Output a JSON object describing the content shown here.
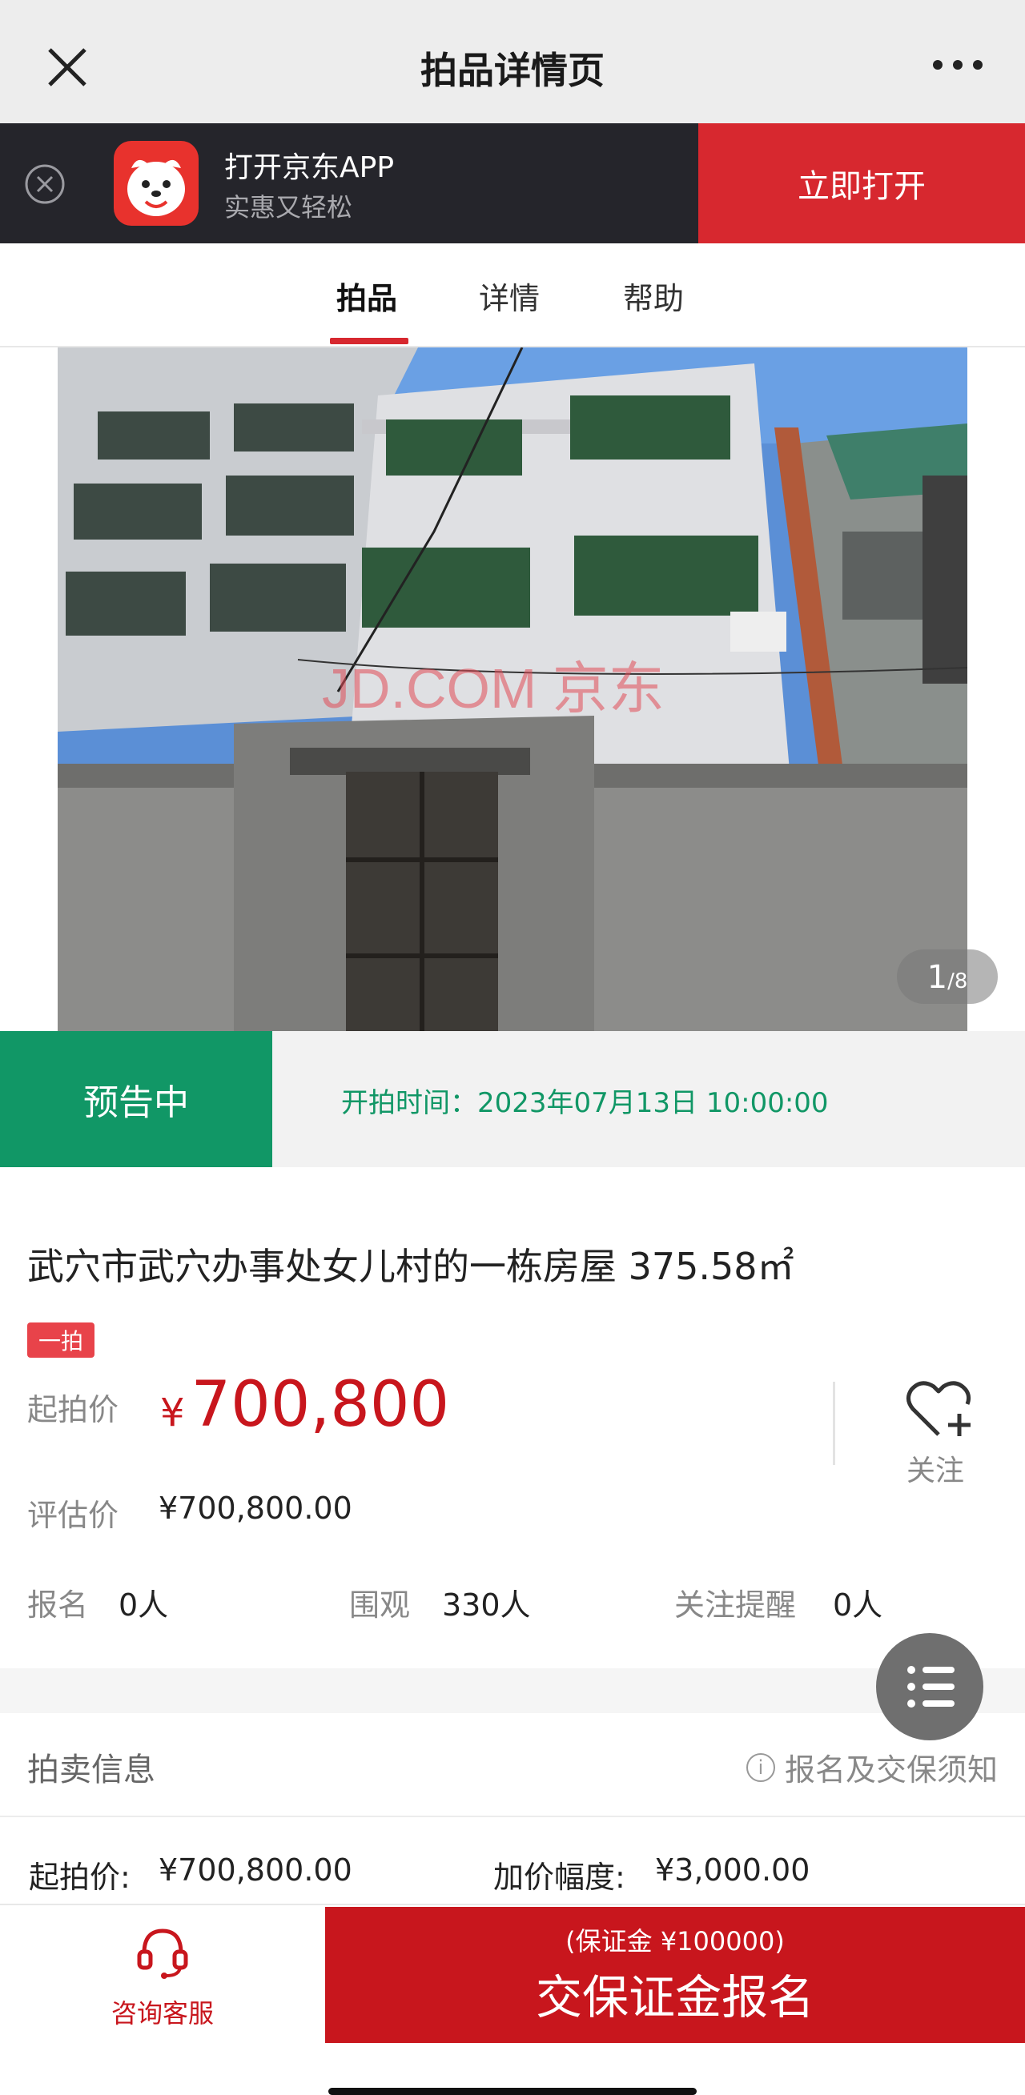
{
  "header": {
    "title": "拍品详情页"
  },
  "app_banner": {
    "name": "打开京东APP",
    "slogan": "实惠又轻松",
    "open_button": "立即打开"
  },
  "tabs": [
    {
      "label": "拍品"
    },
    {
      "label": "详情"
    },
    {
      "label": "帮助"
    }
  ],
  "gallery": {
    "watermark": "JD.COM 京东",
    "current": "1",
    "total": "/8"
  },
  "status": {
    "badge": "预告中",
    "start_time": "开拍时间：2023年07月13日 10:00:00"
  },
  "item": {
    "title": "武穴市武穴办事处女儿村的一栋房屋 375.58㎡",
    "round_tag": "一拍",
    "start_price_label": "起拍价",
    "start_price_currency": "¥",
    "start_price": "700,800",
    "appraisal_label": "评估价",
    "appraisal_value": "¥700,800.00",
    "follow_label": "关注"
  },
  "stats": [
    {
      "label": "报名",
      "value": "0人"
    },
    {
      "label": "围观",
      "value": "330人"
    },
    {
      "label": "关注提醒",
      "value": "0人"
    }
  ],
  "auction_info": {
    "heading": "拍卖信息",
    "notice": "报名及交保须知",
    "start_price_label": "起拍价:",
    "start_price_value": "¥700,800.00",
    "increment_label": "加价幅度:",
    "increment_value": "¥3,000.00"
  },
  "bottom_bar": {
    "service_label": "咨询客服",
    "deposit_note": "(保证金 ¥100000)",
    "apply_button": "交保证金报名"
  },
  "colors": {
    "brand_red": "#c8161d",
    "jd_red": "#d7282f",
    "green": "#119766",
    "banner_bg": "#25252b"
  }
}
